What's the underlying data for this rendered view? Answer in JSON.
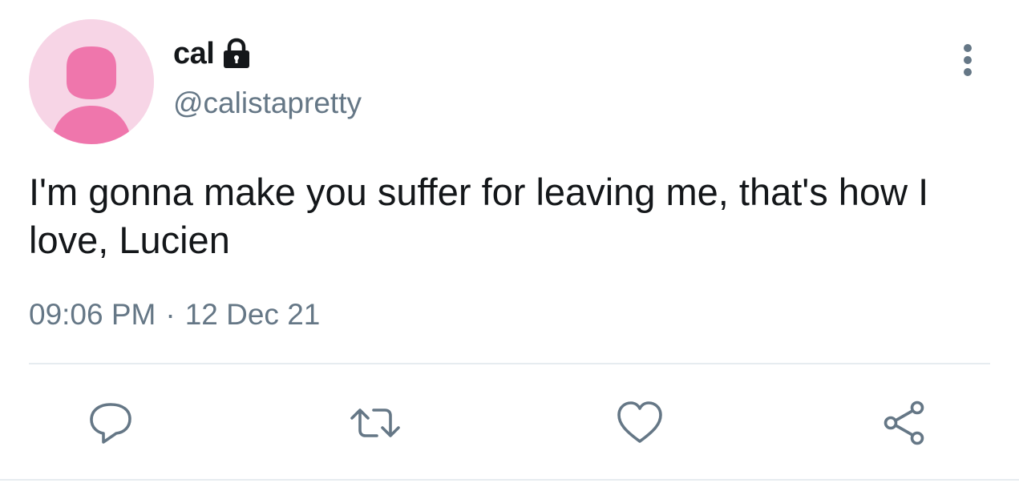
{
  "author": {
    "display_name": "cal",
    "handle": "@calistapretty",
    "protected": true,
    "avatar_icon": "default-profile-icon",
    "avatar_bg": "#f7d5e6",
    "avatar_fg": "#ef76ac"
  },
  "tweet": {
    "text": "I'm gonna make you suffer for leaving me, that's how I love, Lucien",
    "time": "09:06 PM",
    "separator": "·",
    "date": "12 Dec 21"
  },
  "actions": [
    {
      "name": "reply",
      "icon": "reply-icon"
    },
    {
      "name": "retweet",
      "icon": "retweet-icon"
    },
    {
      "name": "like",
      "icon": "heart-icon"
    },
    {
      "name": "share",
      "icon": "share-icon"
    }
  ],
  "colors": {
    "text_primary": "#14171a",
    "text_secondary": "#657786",
    "divider": "#e6ecf0"
  }
}
